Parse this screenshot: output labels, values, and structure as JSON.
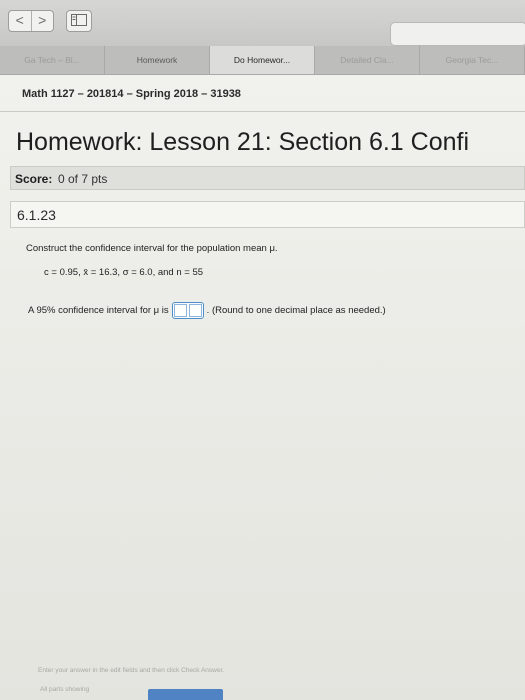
{
  "browser": {
    "tabs": [
      {
        "label": "Ga Tech – Bl..."
      },
      {
        "label": "Homework"
      },
      {
        "label": "Do Homewor..."
      },
      {
        "label": "Detailed Cla..."
      },
      {
        "label": "Georgia Tec..."
      }
    ],
    "nav_back": "<",
    "nav_forward": ">"
  },
  "header": {
    "course": "Math 1127 – 201814 – Spring 2018 – 31938"
  },
  "homework": {
    "title": "Homework: Lesson 21: Section 6.1 Confi",
    "score_label": "Score:",
    "score_value": "0 of 7 pts",
    "question_number": "6.1.23"
  },
  "question": {
    "prompt": "Construct the confidence interval for the population mean μ.",
    "params": "c = 0.95, x̄ = 16.3, σ = 6.0, and n = 55",
    "answer_prefix": "A 95% confidence interval for μ is",
    "answer_suffix": ". (Round to one decimal place as needed.)"
  },
  "footer": {
    "help_text": "Enter your answer in the edit fields and then click Check Answer.",
    "status": "All parts showing"
  }
}
